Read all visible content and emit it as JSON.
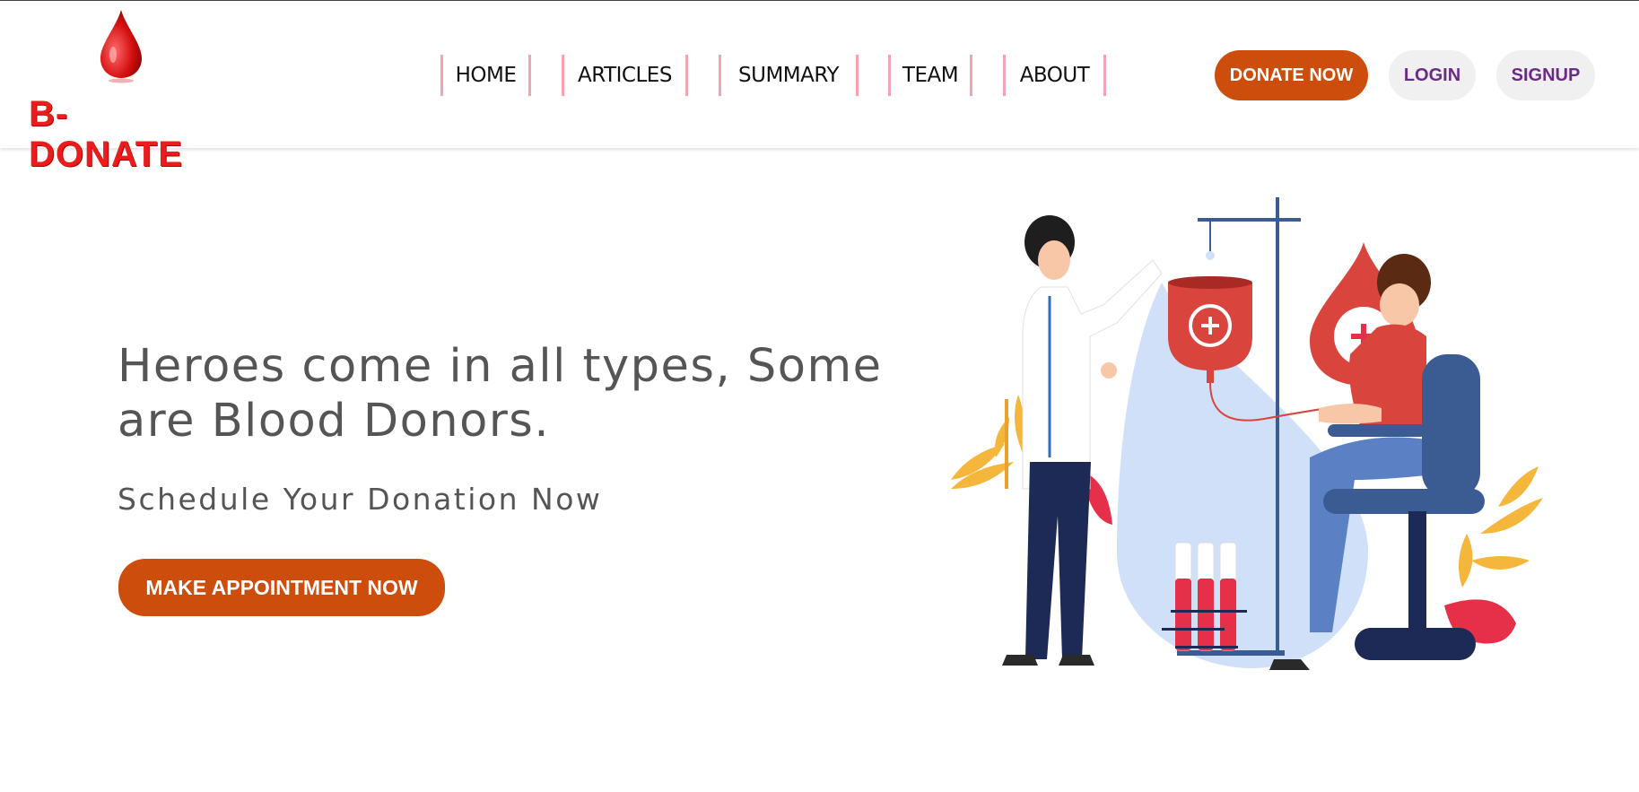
{
  "brand": {
    "name": "B-DONATE",
    "logo_icon": "blood-drop-icon",
    "color": "#ea1c1c"
  },
  "nav": {
    "items": [
      {
        "label": "HOME"
      },
      {
        "label": "ARTICLES"
      },
      {
        "label": "SUMMARY"
      },
      {
        "label": "TEAM"
      },
      {
        "label": "ABOUT"
      }
    ]
  },
  "actions": {
    "donate_label": "DONATE NOW",
    "login_label": "LOGIN",
    "signup_label": "SIGNUP"
  },
  "hero": {
    "heading_line1": "Heroes come in all types, Some",
    "heading_line2": "are Blood Donors.",
    "subheading": "Schedule Your Donation Now",
    "cta_label": "MAKE APPOINTMENT NOW",
    "illustration": "blood-donation-illustration"
  },
  "colors": {
    "accent": "#cc4d0c",
    "secondary_text": "#6b2a86",
    "nav_divider": "#f5a3ad",
    "body_text": "#555555"
  }
}
